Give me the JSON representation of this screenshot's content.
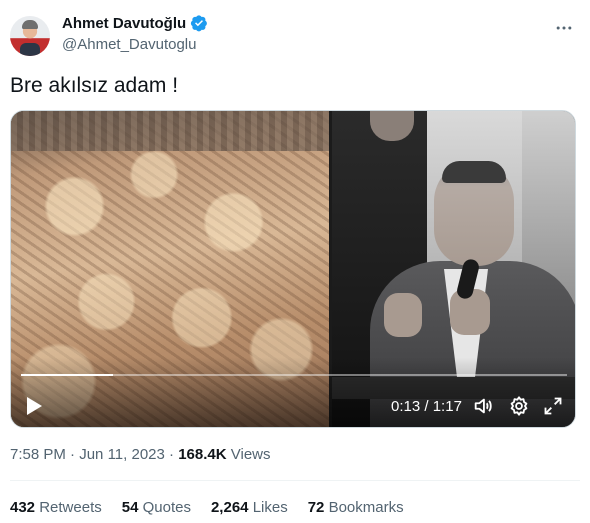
{
  "author": {
    "display_name": "Ahmet Davutoğlu",
    "handle": "@Ahmet_Davutoglu",
    "verified": true
  },
  "tweet": {
    "text": "Bre akılsız adam !"
  },
  "video": {
    "current_time": "0:13",
    "separator": "/",
    "duration": "1:17",
    "progress": 0.169,
    "controls": [
      "play-icon",
      "volume-icon",
      "settings-gear-icon",
      "fullscreen-expand-icon"
    ]
  },
  "meta": {
    "time": "7:58 PM",
    "dot": "·",
    "date": "Jun 11, 2023",
    "views_count": "168.4K",
    "views_label": "Views"
  },
  "stats": [
    {
      "count": "432",
      "label": "Retweets"
    },
    {
      "count": "54",
      "label": "Quotes"
    },
    {
      "count": "2,264",
      "label": "Likes"
    },
    {
      "count": "72",
      "label": "Bookmarks"
    }
  ],
  "colors": {
    "verified_blue": "#1d9bf0",
    "text_primary": "#0f1419",
    "text_secondary": "#536471"
  }
}
